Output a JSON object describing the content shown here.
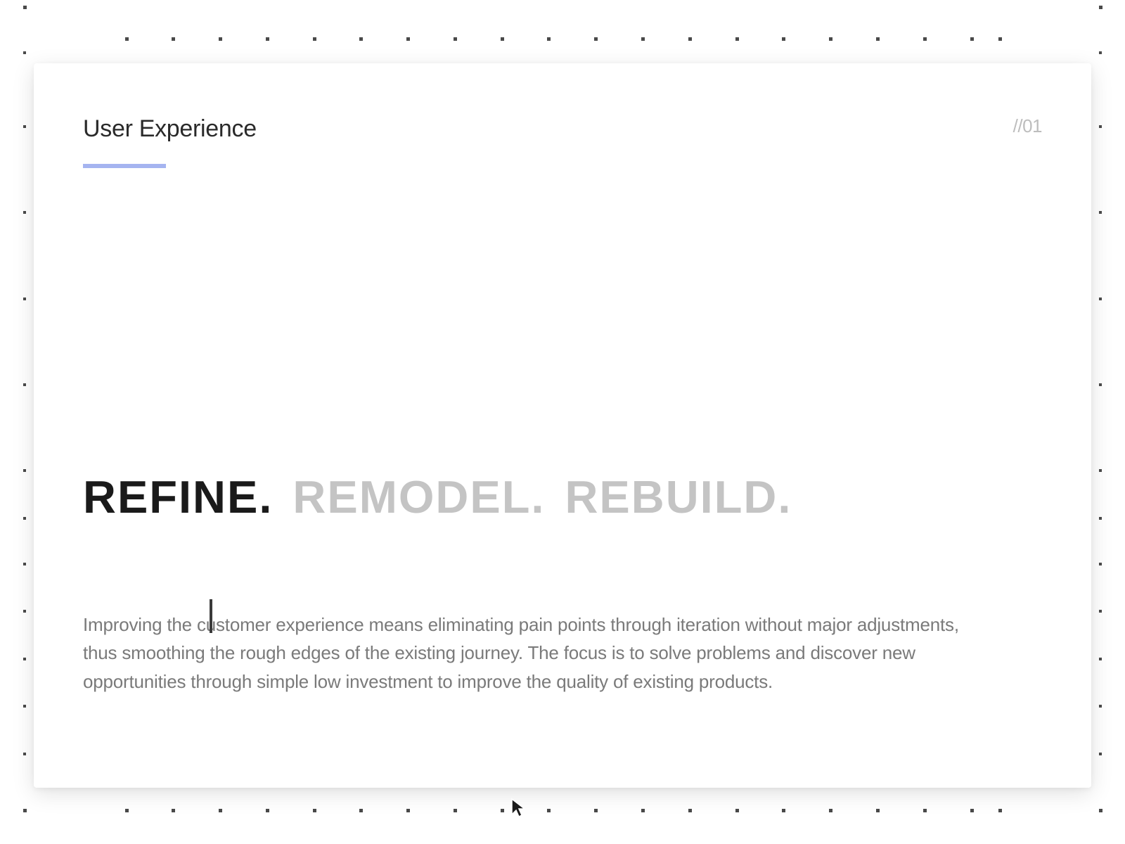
{
  "header": {
    "title": "User Experience",
    "page_marker": "//01"
  },
  "keywords": {
    "active": "REFINE.",
    "inactive_1": "REMODEL.",
    "inactive_2": "REBUILD."
  },
  "body": {
    "paragraph": "Improving the customer experience means eliminating pain points through iteration without major adjustments, thus smoothing the rough edges of the existing journey. The focus is to solve problems and discover new opportunities through simple low investment to improve the quality of existing products."
  },
  "colors": {
    "accent": "#a5b4f0",
    "text_primary": "#1a1a1a",
    "text_secondary": "#7a7a7a",
    "text_muted": "#c4c4c4"
  }
}
